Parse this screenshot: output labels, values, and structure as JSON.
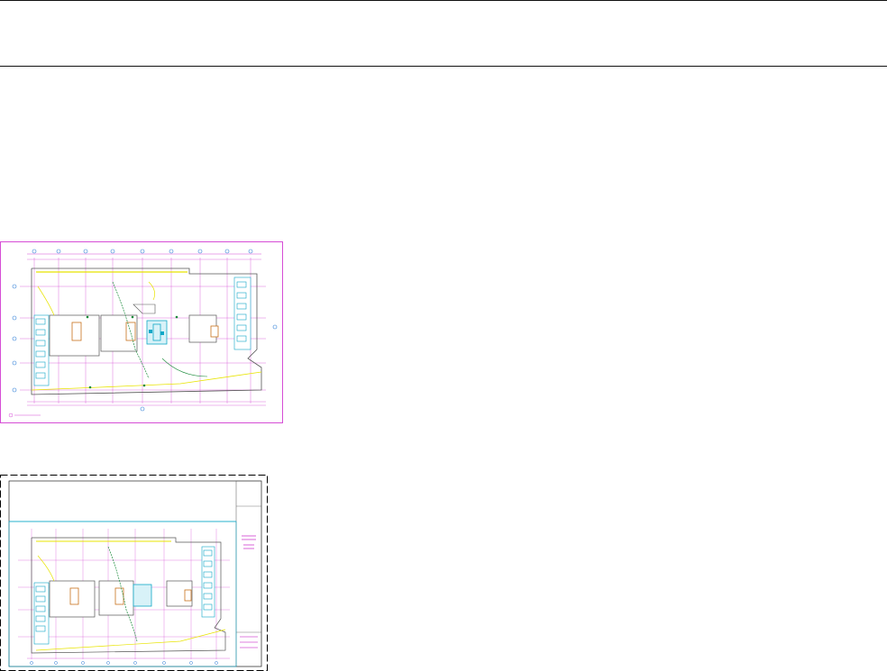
{
  "header": {
    "title": ""
  },
  "thumbnails": [
    {
      "id": "plan-thumbnail-1",
      "kind": "floor-plan",
      "border_color": "#d64dd6"
    },
    {
      "id": "plan-thumbnail-2",
      "kind": "title-sheet",
      "border_color": "#000000"
    }
  ],
  "colors": {
    "magenta": "#d64dd6",
    "cyan": "#10a7c7",
    "yellow": "#e8e400",
    "green": "#1a8a3a",
    "orange": "#c8701b",
    "grey": "#888888"
  }
}
